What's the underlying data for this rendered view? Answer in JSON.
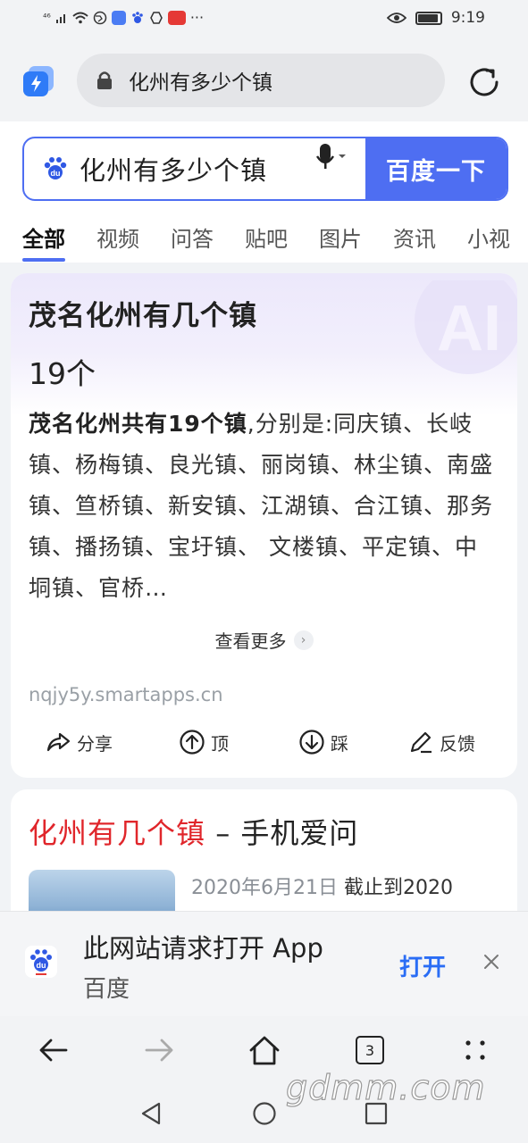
{
  "status_bar": {
    "signal": "⁴⁶",
    "time": "9:19",
    "battery_level": 0.85
  },
  "browser": {
    "url_text": "化州有多少个镇"
  },
  "search": {
    "query": "化州有多少个镇",
    "button_label": "百度一下"
  },
  "tabs": [
    {
      "label": "全部"
    },
    {
      "label": "视频"
    },
    {
      "label": "问答"
    },
    {
      "label": "贴吧"
    },
    {
      "label": "图片"
    },
    {
      "label": "资讯"
    },
    {
      "label": "小视"
    }
  ],
  "ai_card": {
    "title": "茂名化州有几个镇",
    "answer": "19个",
    "body_bold": "茂名化州共有19个镇",
    "body_rest": ",分别是:同庆镇、长岐镇、杨梅镇、良光镇、丽岗镇、林尘镇、南盛镇、笪桥镇、新安镇、江湖镇、合江镇、那务镇、播扬镇、宝圩镇、 文楼镇、平定镇、中垌镇、官桥…",
    "more_label": "查看更多",
    "source": "nqjy5y.smartapps.cn",
    "actions": {
      "share": "分享",
      "up": "顶",
      "down": "踩",
      "feedback": "反馈"
    }
  },
  "result2": {
    "title_highlight": "化州有几个镇",
    "title_rest": " – 手机爱问",
    "date": "2020年6月21日",
    "snippet": " 截止到2020"
  },
  "app_banner": {
    "title": "此网站请求打开 App",
    "subtitle": "百度",
    "open_label": "打开"
  },
  "bottom_nav": {
    "tab_count": "3"
  },
  "watermark": "gdmm.com",
  "colors": {
    "accent": "#4e6ef2",
    "highlight_red": "#e0262b",
    "open_blue": "#2a6df5"
  }
}
